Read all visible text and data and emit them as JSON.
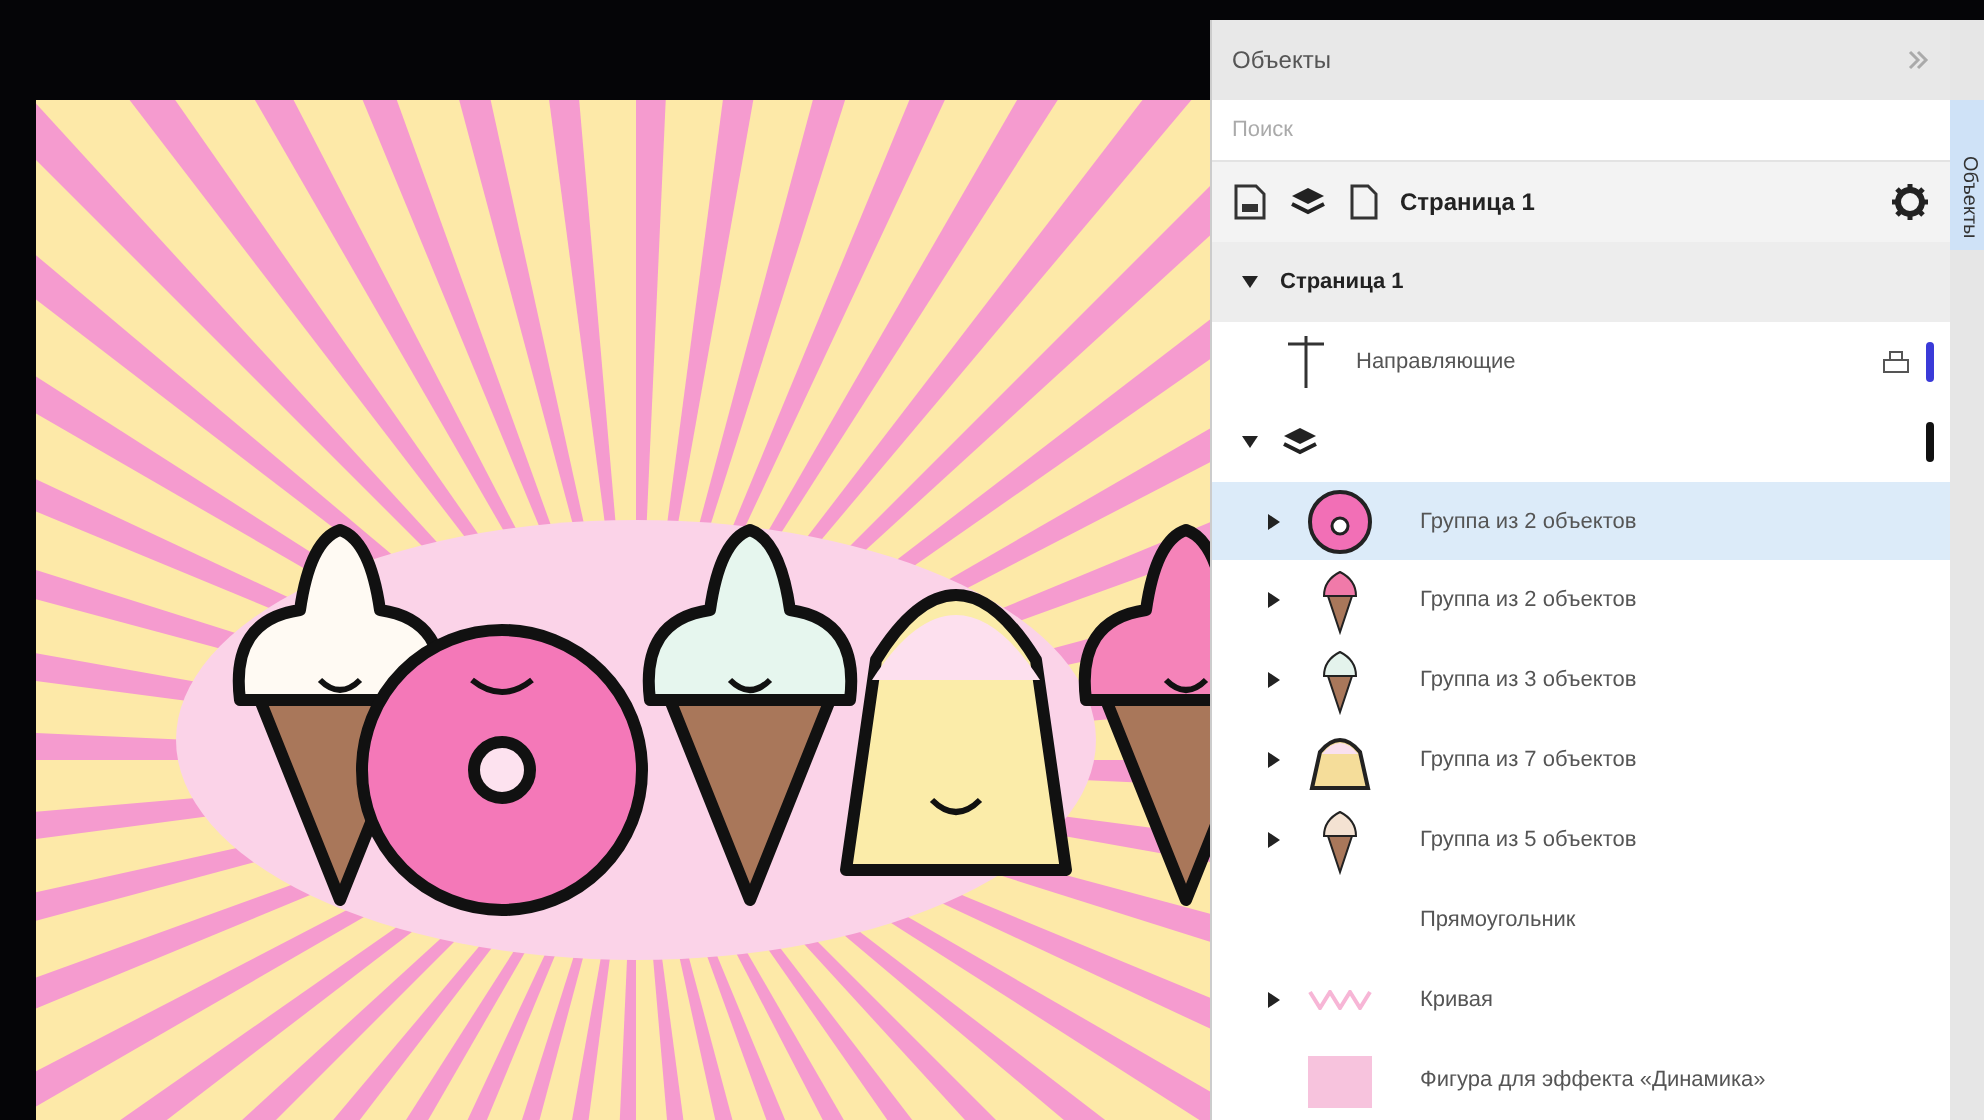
{
  "docker": {
    "title": "Объекты",
    "side_tab": "Объекты",
    "search": {
      "placeholder": "Поиск"
    },
    "toolbar": {
      "page_label": "Страница 1"
    },
    "page": {
      "label": "Страница 1",
      "expanded": true,
      "guides": {
        "label": "Направляющие",
        "color": "#3a3ad8"
      },
      "layer": {
        "expanded": true,
        "color": "#111111",
        "objects": [
          {
            "label": "Группа из 2 объектов",
            "kind": "donut",
            "expanded": false,
            "selected": true
          },
          {
            "label": "Группа из 2 объектов",
            "kind": "cone-pink",
            "expanded": false,
            "selected": false
          },
          {
            "label": "Группа из 3 объектов",
            "kind": "cone-mint",
            "expanded": false,
            "selected": false
          },
          {
            "label": "Группа из 7 объектов",
            "kind": "cake",
            "expanded": false,
            "selected": false
          },
          {
            "label": "Группа из 5 объектов",
            "kind": "cone-brown",
            "expanded": false,
            "selected": false
          },
          {
            "label": "Прямоугольник",
            "kind": "none",
            "selected": false
          },
          {
            "label": "Кривая",
            "kind": "curve",
            "expanded": false,
            "selected": false
          },
          {
            "label": "Фигура для эффекта «Динамика»",
            "kind": "shape",
            "selected": false
          }
        ]
      }
    }
  }
}
